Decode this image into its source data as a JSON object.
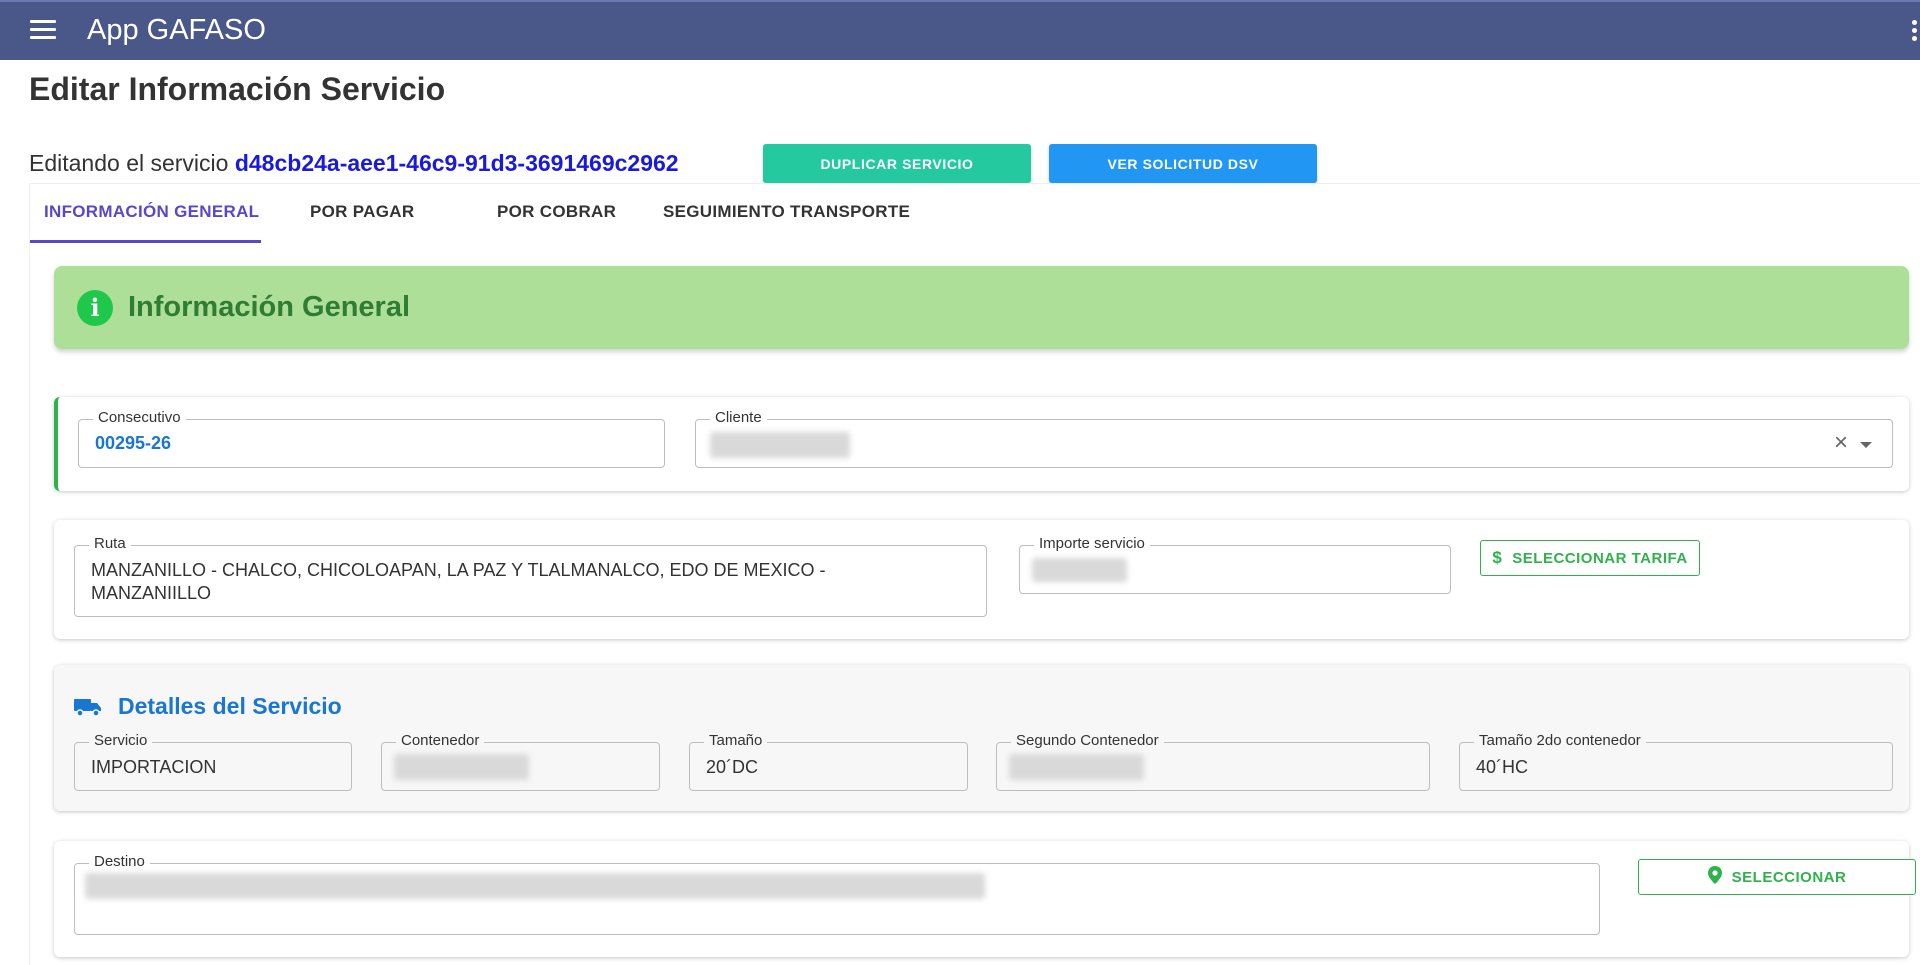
{
  "appbar": {
    "title": "App GAFASO"
  },
  "page": {
    "title": "Editar Información Servicio"
  },
  "editing": {
    "prefix": "Editando el servicio",
    "service_id": "d48cb24a-aee1-46c9-91d3-3691469c2962"
  },
  "actions": {
    "duplicate": "DUPLICAR SERVICIO",
    "view_dsv": "VER SOLICITUD DSV"
  },
  "tabs": [
    {
      "label": "INFORMACIÓN GENERAL"
    },
    {
      "label": "POR PAGAR"
    },
    {
      "label": "POR COBRAR"
    },
    {
      "label": "SEGUIMIENTO TRANSPORTE"
    }
  ],
  "banner": {
    "title": "Información General",
    "icon": "info-icon"
  },
  "general": {
    "consecutivo": {
      "label": "Consecutivo",
      "value": "00295-26"
    },
    "cliente": {
      "label": "Cliente"
    }
  },
  "route": {
    "ruta": {
      "label": "Ruta",
      "line1": "MANZANILLO - CHALCO, CHICOLOAPAN, LA PAZ Y TLALMANALCO, EDO DE MEXICO -",
      "line2": "MANZANIILLO"
    },
    "importe": {
      "label": "Importe servicio"
    },
    "tarifa_button": "SELECCIONAR TARIFA"
  },
  "details": {
    "title": "Detalles del Servicio",
    "servicio": {
      "label": "Servicio",
      "value": "IMPORTACION"
    },
    "contenedor": {
      "label": "Contenedor"
    },
    "tamano": {
      "label": "Tamaño",
      "value": "20´DC"
    },
    "segundo": {
      "label": "Segundo Contenedor"
    },
    "tamano2": {
      "label": "Tamaño 2do contenedor",
      "value": "40´HC"
    }
  },
  "destino": {
    "label": "Destino",
    "select_button": "SELECCIONAR"
  },
  "colors": {
    "appbar": "#4a5889",
    "accent_tab": "#5a47c8",
    "success": "#2fb24b",
    "teal": "#24c9a0",
    "primary": "#2196f3"
  }
}
